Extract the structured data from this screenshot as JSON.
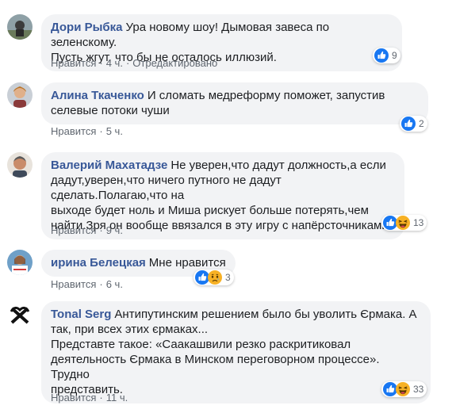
{
  "comments": [
    {
      "author": "Дори Рыбка",
      "text": "Ура новому шоу! Дымовая завеса по зеленскому.\nПусть жгут, что бы не осталось иллюзий.",
      "like_label": "Нравится",
      "time": "4 ч.",
      "edited": "Отредактировано",
      "reaction_count": "9",
      "reactions": [
        "like-icon"
      ]
    },
    {
      "author": "Алина Ткаченко",
      "text": "И сломать медреформу поможет, запустив\nселевые потоки чуши",
      "like_label": "Нравится",
      "time": "5 ч.",
      "reaction_count": "2",
      "reactions": [
        "like-icon"
      ]
    },
    {
      "author": "Валерий Махатадзе",
      "text": "Не уверен,что дадут должность,а если\nдадут,уверен,что ничего путного не дадут сделать.Полагаю,что на\nвыходе будет ноль и Миша рискует больше потерять,чем\nнайти.Зря он вообще ввязался в эту игру с напёрсточниками",
      "like_label": "Нравится",
      "time": "9 ч.",
      "reaction_count": "13",
      "reactions": [
        "like-icon",
        "haha-icon"
      ]
    },
    {
      "author": "ирина Белецкая",
      "text": "Мне нравится",
      "like_label": "Нравится",
      "time": "6 ч.",
      "reaction_count": "3",
      "reactions": [
        "like-icon",
        "sad-icon"
      ]
    },
    {
      "author": "Tonal Serg",
      "text": "Антипутинским решением было бы уволить Єрмака. А\nтак, при всех этих єрмаках...\nПредставте такое: «Саакашвили резко раскритиковал\nдеятельность Єрмака в Минском переговорном процессе». Трудно\nпредставить.",
      "like_label": "Нравится",
      "time": "11 ч.",
      "reaction_count": "33",
      "reactions": [
        "like-icon",
        "haha-icon"
      ]
    }
  ],
  "colors": {
    "author": "#385898",
    "bubble": "#f2f3f5",
    "meta": "#606770",
    "like_blue": "#1877f2",
    "reaction_yellow": "#f7b125"
  }
}
